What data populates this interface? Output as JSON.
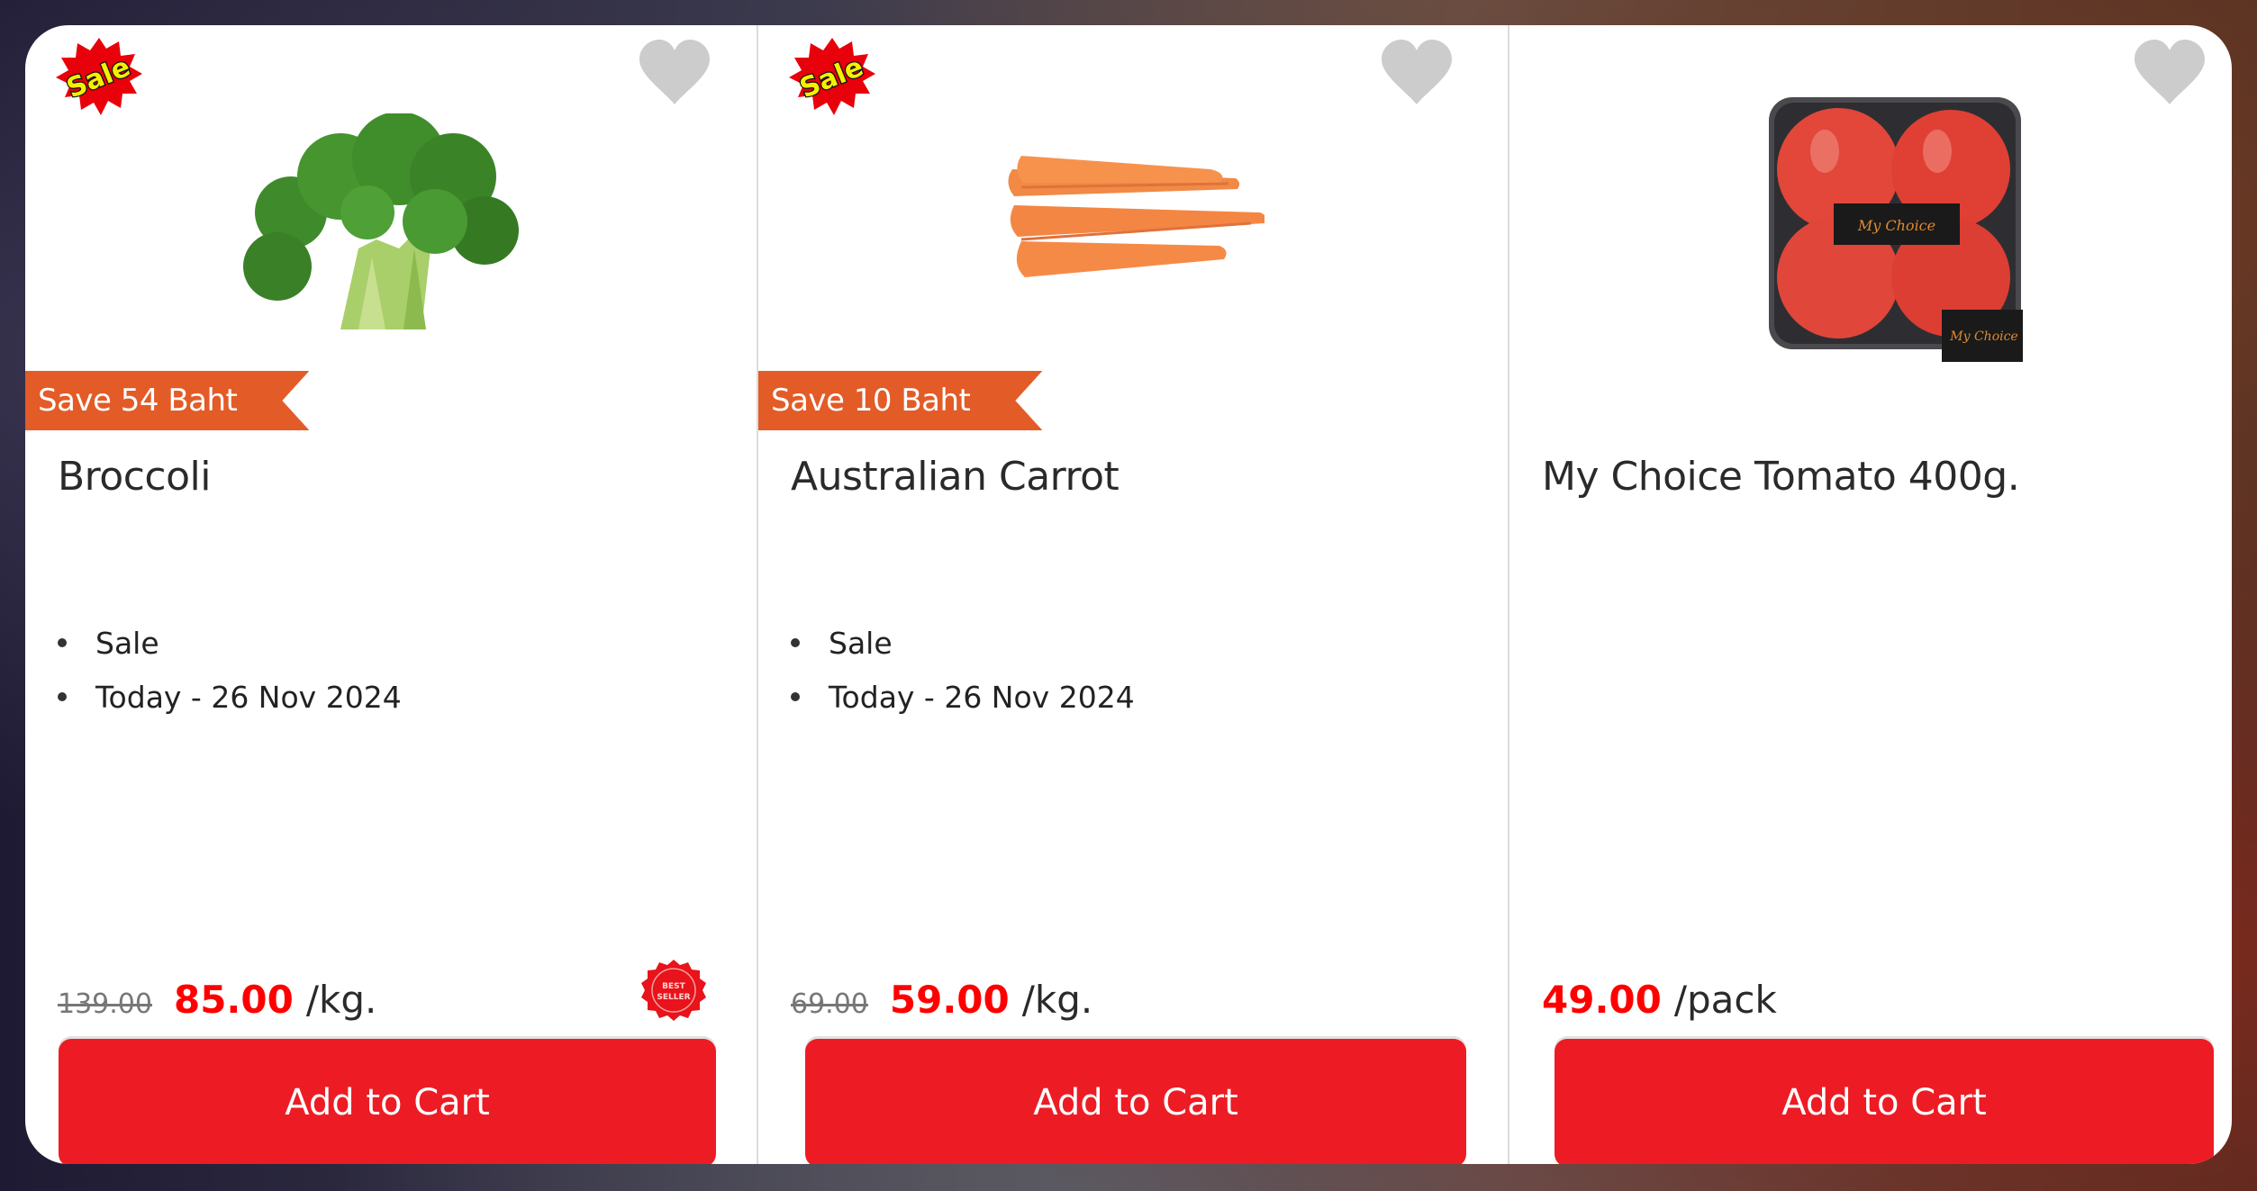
{
  "colors": {
    "brand_red": "#ED1C24",
    "price_red": "#FF0000",
    "ribbon_orange": "#E35B27",
    "heart_gray": "#CCCCCC"
  },
  "products": [
    {
      "name": "Broccoli",
      "image": "broccoli",
      "sale_badge": "Sale",
      "save_label": "Save 54 Baht",
      "bullets": [
        "Sale",
        "Today - 26 Nov 2024"
      ],
      "old_price": "139.00",
      "price": "85.00",
      "unit": "/kg.",
      "best_seller_badge": "BEST SELLER",
      "favorite_icon": "heart-icon",
      "add_to_cart": "Add to Cart"
    },
    {
      "name": "Australian Carrot",
      "image": "carrot",
      "sale_badge": "Sale",
      "save_label": "Save 10 Baht",
      "bullets": [
        "Sale",
        "Today - 26 Nov 2024"
      ],
      "old_price": "69.00",
      "price": "59.00",
      "unit": "/kg.",
      "favorite_icon": "heart-icon",
      "add_to_cart": "Add to Cart"
    },
    {
      "name": "My Choice Tomato 400g.",
      "image": "tomato-pack",
      "price": "49.00",
      "unit": "/pack",
      "package_label": "My Choice",
      "favorite_icon": "heart-icon",
      "add_to_cart": "Add to Cart"
    }
  ]
}
